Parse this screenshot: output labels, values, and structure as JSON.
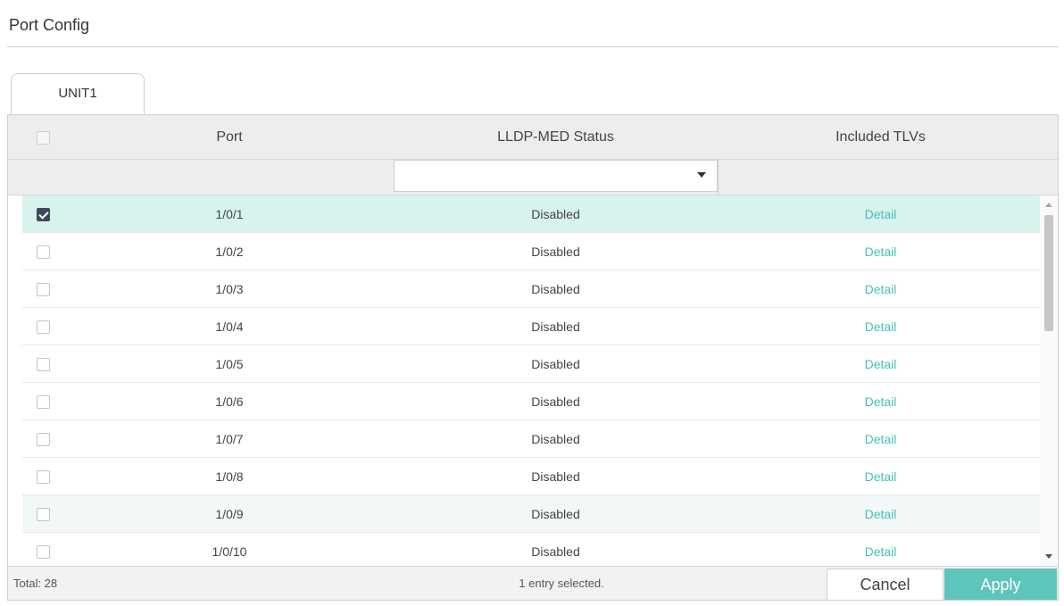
{
  "panel": {
    "title": "Port Config"
  },
  "tabs": [
    {
      "label": "UNIT1",
      "active": true
    }
  ],
  "table": {
    "columns": [
      "Port",
      "LLDP-MED Status",
      "Included TLVs"
    ],
    "filter": {
      "status_value": ""
    },
    "rows": [
      {
        "checked": true,
        "state": "selected",
        "port": "1/0/1",
        "status": "Disabled",
        "tlvs": "Detail"
      },
      {
        "checked": false,
        "state": "",
        "port": "1/0/2",
        "status": "Disabled",
        "tlvs": "Detail"
      },
      {
        "checked": false,
        "state": "",
        "port": "1/0/3",
        "status": "Disabled",
        "tlvs": "Detail"
      },
      {
        "checked": false,
        "state": "",
        "port": "1/0/4",
        "status": "Disabled",
        "tlvs": "Detail"
      },
      {
        "checked": false,
        "state": "",
        "port": "1/0/5",
        "status": "Disabled",
        "tlvs": "Detail"
      },
      {
        "checked": false,
        "state": "",
        "port": "1/0/6",
        "status": "Disabled",
        "tlvs": "Detail"
      },
      {
        "checked": false,
        "state": "",
        "port": "1/0/7",
        "status": "Disabled",
        "tlvs": "Detail"
      },
      {
        "checked": false,
        "state": "",
        "port": "1/0/8",
        "status": "Disabled",
        "tlvs": "Detail"
      },
      {
        "checked": false,
        "state": "hover",
        "port": "1/0/9",
        "status": "Disabled",
        "tlvs": "Detail"
      },
      {
        "checked": false,
        "state": "",
        "port": "1/0/10",
        "status": "Disabled",
        "tlvs": "Detail"
      }
    ]
  },
  "footer": {
    "total": "Total: 28",
    "selected_info": "1 entry selected.",
    "cancel_label": "Cancel",
    "apply_label": "Apply"
  },
  "colors": {
    "accent": "#5ec5bb",
    "link": "#46c0b5",
    "selected_row": "#d8f2ee",
    "checkbox_checked": "#3d4a59"
  },
  "icons": {
    "select_arrow": "caret-down-icon",
    "scroll_up": "scroll-up-icon",
    "scroll_down": "scroll-down-icon",
    "check": "check-icon"
  }
}
